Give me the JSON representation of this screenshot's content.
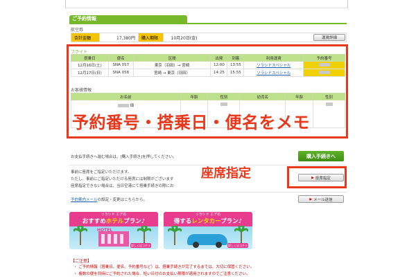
{
  "section": {
    "title": "ご予約情報"
  },
  "ticket": {
    "label": "航空券",
    "total_label": "合計金額",
    "total_value": "17,380円",
    "deadline_label": "購入期限",
    "deadline_value": "10月20日(金)",
    "fare_detail_button": "運賃詳細"
  },
  "flight": {
    "label": "フライト",
    "headers": [
      "搭乗日",
      "便名",
      "区間",
      "出発",
      "到着",
      "利用運賃",
      "予約番号"
    ],
    "rows": [
      {
        "date": "12月16日(土)",
        "flight_no": "SNA 057",
        "route": "東京（羽田）→ 宮崎",
        "dep": "12:00",
        "arr": "13:55",
        "fare": "ソラシドスペシャル"
      },
      {
        "date": "12月17日(日)",
        "flight_no": "SNA 058",
        "route": "宮崎 → 東京（羽田）",
        "dep": "14:25",
        "arr": "15:55",
        "fare": "ソラシドスペシャル"
      }
    ]
  },
  "passenger": {
    "label": "お客様情報",
    "headers": [
      "お名前",
      "年齢",
      "性別",
      "幼児名",
      "年齢",
      "性別"
    ],
    "name_fragment": "畑"
  },
  "annotations": {
    "memo": "予約番号・搭乗日・便名をメモ",
    "seat": "座席指定"
  },
  "purchase": {
    "instruction": "お支払手続きへ進む場合は、[購入手続き]を押してください。",
    "button": "購入手続きへ"
  },
  "seat_block": {
    "line1": "事前に座席をご指定いただけます。",
    "line2": "ただし、事前にご指定いただける座席には制限がございます",
    "line3": "座席指定できない場合は、当日空港にて搭乗手続きの際にお",
    "button": "座席指定"
  },
  "mail_block": {
    "link_text": "予約案内メール",
    "text_rest": "の設定・変更はこちらから。",
    "button": "メール送信"
  },
  "banners": {
    "hotel": {
      "brand": "ソラシド エアの",
      "title_pre": "おすすめ",
      "title_em": "ホテル",
      "title_post": "プラン♪",
      "sub": "HOTEL",
      "cta": "詳しくはコチラ"
    },
    "car": {
      "brand": "ソラシド エアの",
      "title_pre": "得する",
      "title_em": "レンタカー",
      "title_post": "プラン♪",
      "cta": "詳しくはコチラ"
    }
  },
  "notices": {
    "title": "【ご注意】",
    "line1": "・ ご予約情報（搭乗日、便名、予約番号など）は、搭乗手続きが完了するまでは、大切に保管ください。",
    "line2": "・ 複数の便を同時にご予約された場合、短い日付のお支払い期限が適用されますのでご注意ください。"
  }
}
